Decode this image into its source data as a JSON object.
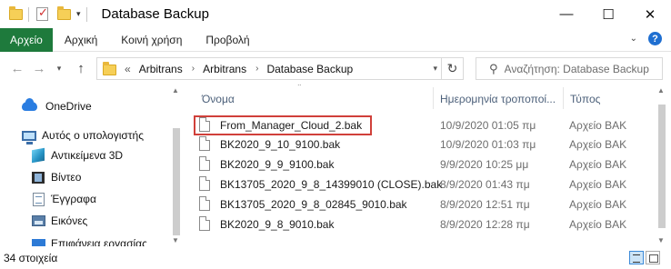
{
  "window": {
    "title": "Database Backup",
    "controls": {
      "minimize": "—",
      "maximize": "☐",
      "close": "✕"
    }
  },
  "quick_access": {
    "icons": [
      "folder-icon",
      "properties-icon",
      "new-folder-icon",
      "customize-dropdown-icon"
    ]
  },
  "ribbon": {
    "tabs": [
      {
        "label": "Αρχείο",
        "active": true
      },
      {
        "label": "Αρχική",
        "active": false
      },
      {
        "label": "Κοινή χρήση",
        "active": false
      },
      {
        "label": "Προβολή",
        "active": false
      }
    ],
    "expand_glyph": "⌄",
    "help_glyph": "?"
  },
  "address_bar": {
    "overflow": "«",
    "breadcrumbs": [
      "Arbitrans",
      "Arbitrans",
      "Database Backup"
    ],
    "separator": "›"
  },
  "search": {
    "placeholder": "Αναζήτηση: Database Backup"
  },
  "nav_pane": {
    "items": [
      {
        "label": "OneDrive",
        "icon": "onedrive-icon"
      },
      {
        "label": "Αυτός ο υπολογιστής",
        "icon": "computer-icon"
      },
      {
        "label": "Αντικείμενα 3D",
        "icon": "3d-objects-icon"
      },
      {
        "label": "Βίντεο",
        "icon": "videos-icon"
      },
      {
        "label": "Έγγραφα",
        "icon": "documents-icon"
      },
      {
        "label": "Εικόνες",
        "icon": "pictures-icon"
      },
      {
        "label": "Επιφάνεια εργασίας",
        "icon": "desktop-icon"
      }
    ]
  },
  "file_list": {
    "columns": {
      "name": "Όνομα",
      "date": "Ημερομηνία τροποποί...",
      "type": "Τύπος"
    },
    "files": [
      {
        "name": "From_Manager_Cloud_2.bak",
        "date": "10/9/2020 01:05 πμ",
        "type": "Αρχείο BAK",
        "highlighted": true
      },
      {
        "name": "BK2020_9_10_9100.bak",
        "date": "10/9/2020 01:03 πμ",
        "type": "Αρχείο BAK"
      },
      {
        "name": "BK2020_9_9_9100.bak",
        "date": "9/9/2020 10:25 μμ",
        "type": "Αρχείο BAK"
      },
      {
        "name": "BK13705_2020_9_8_14399010 (CLOSE).bak",
        "date": "8/9/2020 01:43 πμ",
        "type": "Αρχείο BAK"
      },
      {
        "name": "BK13705_2020_9_8_02845_9010.bak",
        "date": "8/9/2020 12:51 πμ",
        "type": "Αρχείο BAK"
      },
      {
        "name": "BK2020_9_8_9010.bak",
        "date": "8/9/2020 12:28 πμ",
        "type": "Αρχείο BAK"
      }
    ],
    "highlight_color": "#d0403a"
  },
  "status_bar": {
    "item_count": "34 στοιχεία",
    "view_modes": [
      "details-view-icon",
      "large-icons-view-icon"
    ]
  },
  "colors": {
    "file_tab_bg": "#1e7a3c",
    "folder_yellow": "#f6cf57",
    "header_text": "#4c607a",
    "secondary_text": "#6d6d6d"
  }
}
